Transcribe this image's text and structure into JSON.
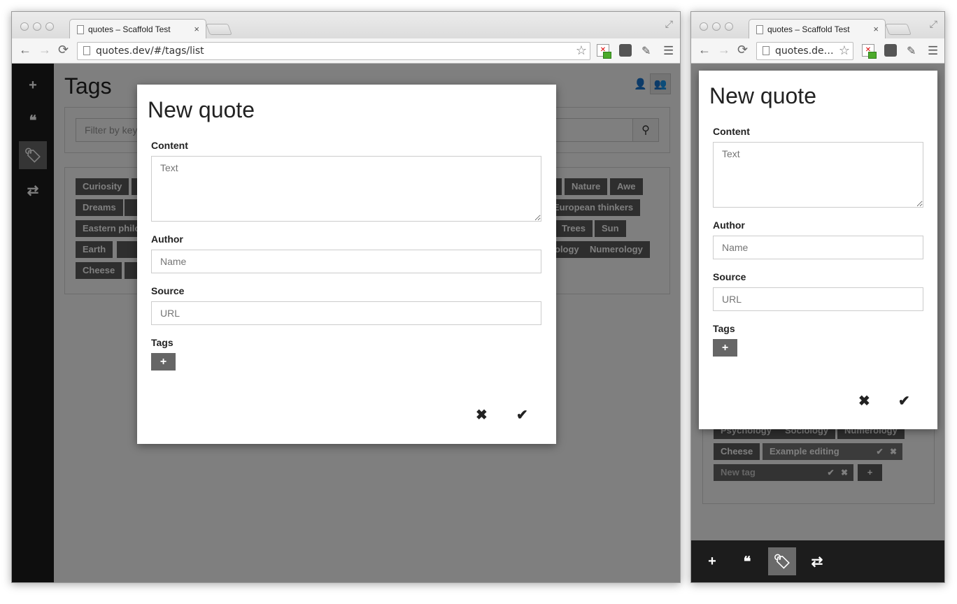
{
  "browser": {
    "tab_title": "quotes – Scaffold Test",
    "tab_close": "×",
    "url_full": "quotes.dev/#/tags/list",
    "url_short": "quotes.de…"
  },
  "icons": {
    "back": "←",
    "forward": "→",
    "reload": "⟳",
    "star": "☆",
    "menu": "☰",
    "plus": "+",
    "quote": "❝",
    "tags": "🏷",
    "shuffle": "⇄",
    "search": "⚲",
    "close": "✖",
    "check": "✔",
    "user": "👤",
    "users": "👥",
    "resize": "⤢",
    "ext_x": "✕",
    "picker": "✎"
  },
  "page": {
    "title": "Tags",
    "search_placeholder": "Filter by keyword"
  },
  "tags_left": [
    "Curiosity",
    "Nature",
    "Awe",
    "Dreams",
    "European thinkers",
    "Eastern philosophy",
    "Trees",
    "Sun",
    "Earth",
    "ology",
    "Numerology",
    "Cheese"
  ],
  "tags_right": {
    "row1": [
      "Psychology",
      "Sociology",
      "Numerology"
    ],
    "cheese": "Cheese",
    "editing": "Example editing",
    "newtag": "New tag"
  },
  "modal": {
    "title": "New quote",
    "content_label": "Content",
    "content_placeholder": "Text",
    "author_label": "Author",
    "author_placeholder": "Name",
    "source_label": "Source",
    "source_placeholder": "URL",
    "tags_label": "Tags"
  }
}
